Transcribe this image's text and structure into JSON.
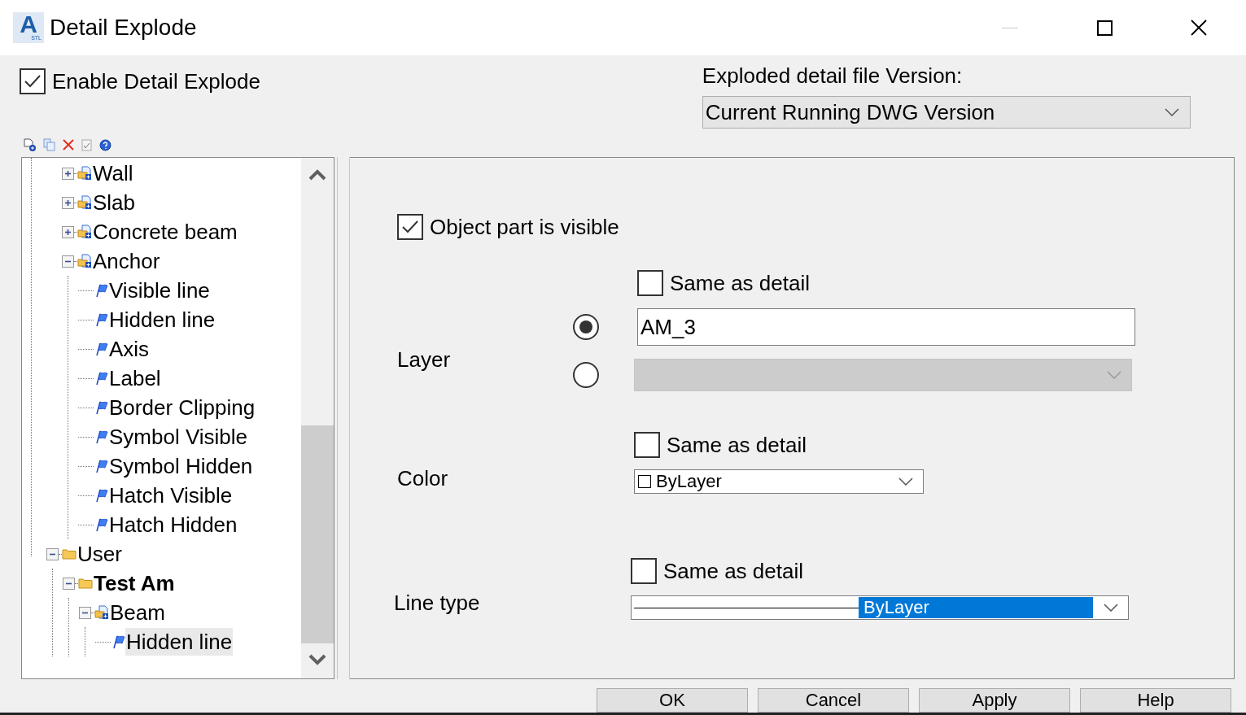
{
  "window": {
    "app_icon": {
      "letter": "A",
      "caption": "STL"
    },
    "title": "Detail Explode",
    "minimize_disabled": true
  },
  "enable": {
    "label": "Enable Detail Explode",
    "checked": true
  },
  "version": {
    "label": "Exploded detail file Version:",
    "value": "Current Running DWG Version"
  },
  "tree": {
    "scrolled_items": [
      {
        "label": "Wall",
        "kind": "group",
        "expanded": false,
        "bold": false,
        "selected": false
      },
      {
        "label": "Slab",
        "kind": "group",
        "expanded": false,
        "bold": false,
        "selected": false
      },
      {
        "label": "Concrete beam",
        "kind": "group",
        "expanded": false,
        "bold": false,
        "selected": false
      },
      {
        "label": "Anchor",
        "kind": "group",
        "expanded": true,
        "bold": false,
        "selected": false,
        "children": [
          {
            "label": "Visible line",
            "kind": "part",
            "bold": false,
            "selected": false
          },
          {
            "label": "Hidden line",
            "kind": "part",
            "bold": false,
            "selected": false
          },
          {
            "label": "Axis",
            "kind": "part",
            "bold": false,
            "selected": false
          },
          {
            "label": "Label",
            "kind": "part",
            "bold": false,
            "selected": false
          },
          {
            "label": "Border Clipping",
            "kind": "part",
            "bold": false,
            "selected": false
          },
          {
            "label": "Symbol Visible",
            "kind": "part",
            "bold": false,
            "selected": false
          },
          {
            "label": "Symbol Hidden",
            "kind": "part",
            "bold": false,
            "selected": false
          },
          {
            "label": "Hatch Visible",
            "kind": "part",
            "bold": false,
            "selected": false
          },
          {
            "label": "Hatch Hidden",
            "kind": "part",
            "bold": false,
            "selected": false
          }
        ]
      }
    ],
    "items": [
      {
        "label": "User",
        "kind": "folder",
        "expanded": true,
        "bold": false,
        "selected": false,
        "children": [
          {
            "label": "Test Am",
            "kind": "folder",
            "expanded": true,
            "bold": true,
            "selected": false,
            "children": [
              {
                "label": "Beam",
                "kind": "group",
                "expanded": true,
                "bold": false,
                "selected": false,
                "children": [
                  {
                    "label": "Hidden line",
                    "kind": "part",
                    "bold": false,
                    "selected": true
                  }
                ]
              }
            ]
          }
        ]
      }
    ]
  },
  "part": {
    "visible": {
      "label": "Object part is visible",
      "checked": true
    },
    "layer": {
      "label": "Layer",
      "same": {
        "label": "Same as detail",
        "checked": false
      },
      "options": [
        {
          "kind": "input",
          "value": "AM_3",
          "selected": true,
          "disabled": false
        },
        {
          "kind": "list",
          "selected": false,
          "disabled": true
        }
      ]
    },
    "color": {
      "label": "Color",
      "same": {
        "label": "Same as detail",
        "checked": false
      },
      "value": "ByLayer"
    },
    "linetype": {
      "label": "Line type",
      "same": {
        "label": "Same as detail",
        "checked": false
      },
      "value": "ByLayer"
    }
  },
  "buttons": [
    "OK",
    "Cancel",
    "Apply",
    "Help"
  ]
}
